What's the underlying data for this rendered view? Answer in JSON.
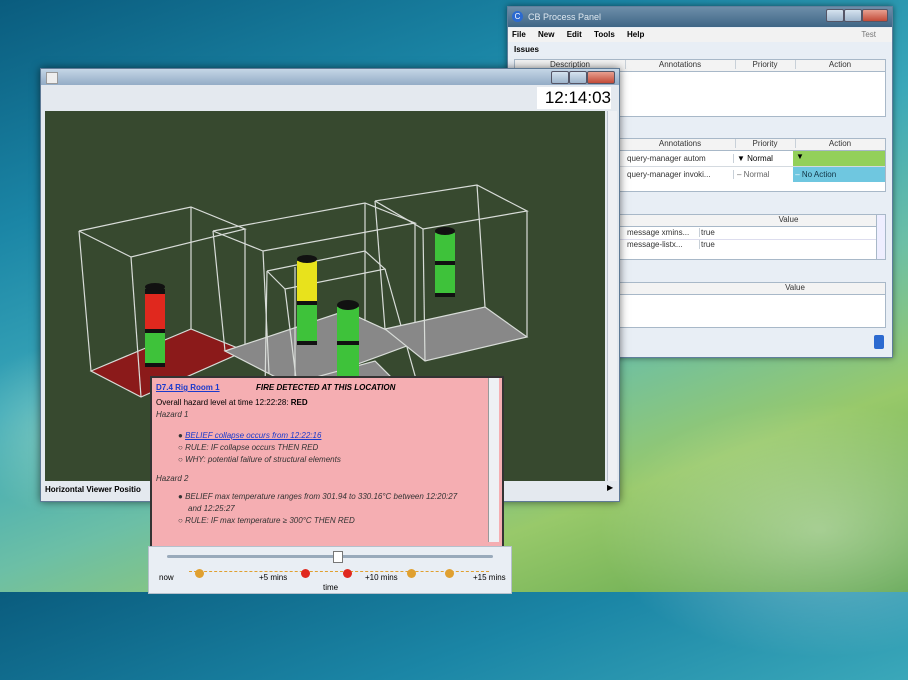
{
  "process_panel": {
    "title": "CB Process Panel",
    "menu": [
      "File",
      "New",
      "Edit",
      "Tools",
      "Help"
    ],
    "menu_right": "Test",
    "issues_label": "Issues",
    "issues_headers": [
      "Description",
      "Annotations",
      "Priority",
      "Action"
    ],
    "tasks_headers": [
      "Annotations",
      "Priority",
      "Action"
    ],
    "tasks_rows": [
      {
        "annotation": "query-manager autom",
        "priority": "Normal",
        "action": ""
      },
      {
        "annotation": "query-manager invoki...",
        "priority": "Normal",
        "action": "No Action"
      }
    ],
    "props_header": "Value",
    "props_rows": [
      {
        "name": "message xmins...",
        "value": "true"
      },
      {
        "name": "message-listx...",
        "value": "true"
      }
    ],
    "bottom_header": "Value"
  },
  "viewer": {
    "clock": "12:14:03",
    "status_label": "Horizontal Viewer Positio"
  },
  "popup": {
    "location_link": "D7.4 Rig Room 1",
    "headline": "FIRE DETECTED AT THIS LOCATION",
    "overall_prefix": "Overall hazard level at time 12:22:28:",
    "overall_level": "RED",
    "hazard1_label": "Hazard 1",
    "hazard1_belief": "BELIEF collapse occurs from 12:22:16",
    "hazard1_rule": "RULE: IF collapse occurs THEN RED",
    "hazard1_why": "WHY: potential failure of structural elements",
    "hazard2_label": "Hazard 2",
    "hazard2_belief_a": "BELIEF max temperature ranges from 301.94 to 330.16°C between 12:20:27",
    "hazard2_belief_b": "and 12:25:27",
    "hazard2_rule": "RULE: IF max temperature ≥ 300°C THEN RED"
  },
  "timeline": {
    "now": "now",
    "plus5": "+5 mins",
    "plus10": "+10 mins",
    "plus15": "+15 mins",
    "axis": "time",
    "slider_position": 0.52
  },
  "colors": {
    "fire_floor": "#8b1a1a",
    "hazard_red": "#e0281e",
    "safe_green": "#3ec23a",
    "warn_yellow": "#e8e21c",
    "popup_bg": "#f5aeb2"
  }
}
